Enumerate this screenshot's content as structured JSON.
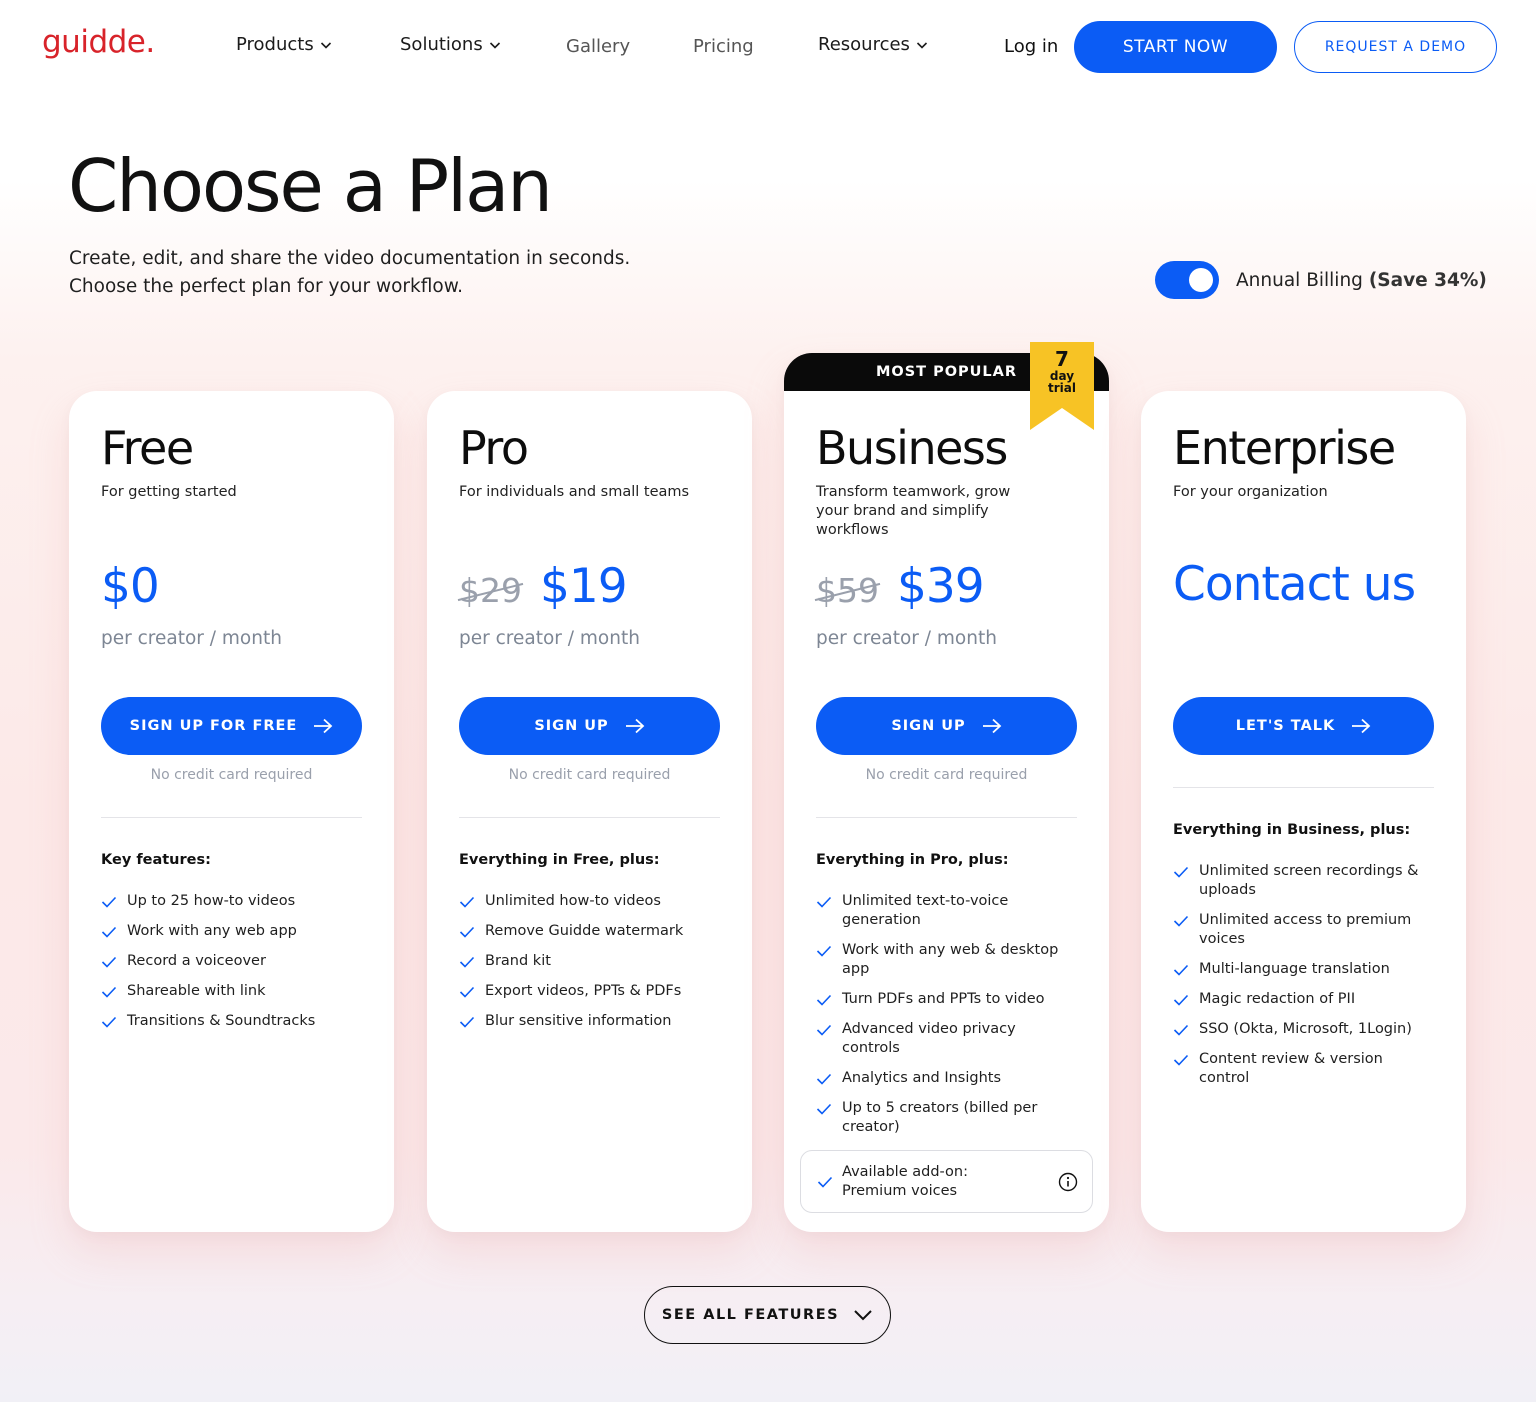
{
  "nav": {
    "logo": "guidde.",
    "products": "Products",
    "solutions": "Solutions",
    "gallery": "Gallery",
    "pricing": "Pricing",
    "resources": "Resources",
    "login": "Log in",
    "start_now": "START NOW",
    "request_demo": "REQUEST A DEMO"
  },
  "hero": {
    "title": "Choose a Plan",
    "subtitle_line1": "Create, edit, and share the video documentation in seconds.",
    "subtitle_line2": "Choose the perfect plan for your workflow."
  },
  "billing": {
    "label": "Annual Billing",
    "save": "(Save 34%)",
    "annual_enabled": true
  },
  "plans": {
    "free": {
      "name": "Free",
      "desc": "For getting started",
      "price": "$0",
      "per": "per creator / month",
      "cta": "SIGN UP FOR FREE",
      "note": "No credit card required",
      "features_head": "Key features:",
      "features": [
        "Up to 25 how-to videos",
        "Work with any web app",
        "Record a voiceover",
        "Shareable with link",
        "Transitions & Soundtracks"
      ]
    },
    "pro": {
      "name": "Pro",
      "desc": "For individuals and small teams",
      "old_price": "$29",
      "price": "$19",
      "per": "per creator / month",
      "cta": "SIGN UP",
      "note": "No credit card required",
      "features_head": "Everything in Free, plus:",
      "features": [
        "Unlimited how-to videos",
        "Remove Guidde watermark",
        "Brand kit",
        "Export videos, PPTs & PDFs",
        "Blur sensitive information"
      ]
    },
    "business": {
      "badge": "MOST POPULAR",
      "ribbon_num": "7",
      "ribbon_line1": "day",
      "ribbon_line2": "trial",
      "name": "Business",
      "desc": "Transform teamwork, grow your brand and simplify workflows",
      "old_price": "$59",
      "price": "$39",
      "per": "per creator / month",
      "cta": "SIGN UP",
      "note": "No credit card required",
      "features_head": "Everything in Pro, plus:",
      "features": [
        "Unlimited text-to-voice generation",
        "Work with any web & desktop app",
        "Turn PDFs and PPTs to video",
        "Advanced video privacy controls",
        "Analytics and Insights",
        "Up to 5 creators (billed per creator)"
      ],
      "addon_line1": "Available add-on:",
      "addon_line2": "Premium voices"
    },
    "enterprise": {
      "name": "Enterprise",
      "desc": "For your organization",
      "price": "Contact us",
      "cta": "LET'S TALK",
      "features_head": "Everything in Business, plus:",
      "features": [
        "Unlimited screen recordings & uploads",
        "Unlimited access to premium voices",
        "Multi-language translation",
        "Magic redaction of PII",
        "SSO (Okta, Microsoft, 1Login)",
        "Content review & version control"
      ]
    }
  },
  "see_all": "SEE ALL FEATURES",
  "colors": {
    "accent": "#0b5cf5",
    "logo": "#d8232a",
    "ribbon": "#f7c325"
  },
  "icons": [
    "chevron-down-icon",
    "arrow-right-icon",
    "check-icon",
    "info-icon"
  ]
}
